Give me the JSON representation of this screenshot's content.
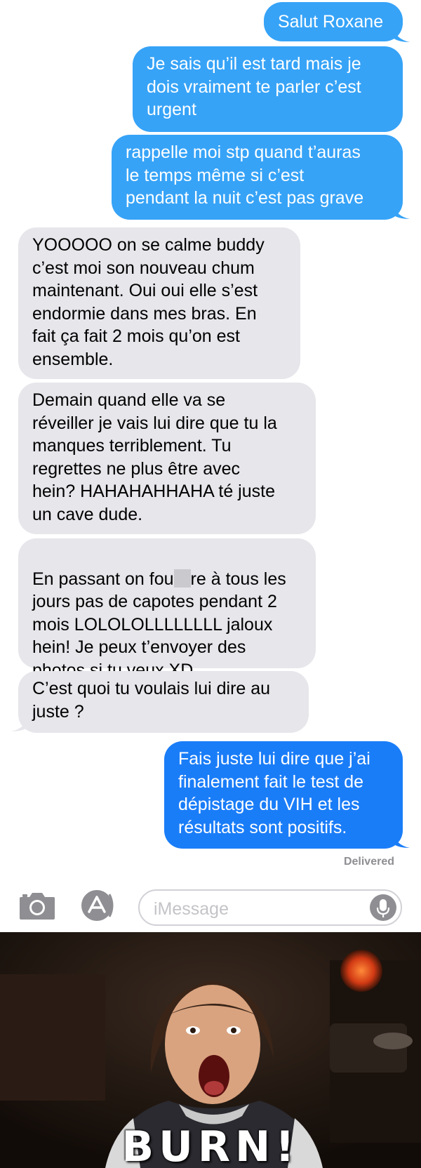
{
  "messages": [
    {
      "dir": "out",
      "text": "Salut Roxane"
    },
    {
      "dir": "out",
      "text": "Je sais qu’il est tard mais je\ndois vraiment te parler c’est\nurgent"
    },
    {
      "dir": "out",
      "text": "rappelle moi stp quand t’auras\nle temps même si c’est\npendant la nuit c’est pas grave"
    },
    {
      "dir": "in",
      "text": "YOOOOO on se calme buddy\nc’est moi son nouveau chum\nmaintenant. Oui oui elle s’est\nendormie dans mes bras. En\nfait ça fait 2 mois qu’on est\nensemble."
    },
    {
      "dir": "in",
      "text": "Demain quand elle va se\nréveiller je vais lui dire que tu la\nmanques terriblement. Tu\nregrettes ne plus être avec\nhein? HAHAHAHHAHA té juste\nun cave dude."
    },
    {
      "dir": "in",
      "text_before_censor": "En passant on fou",
      "text_after_censor": "re à tous les\njours pas de capotes pendant 2\nmois LOLOLOLLLLLLLL jaloux\nhein! Je peux t’envoyer des\nphotos si tu veux XD"
    },
    {
      "dir": "in",
      "text": "C’est quoi tu voulais lui dire au\njuste ?"
    },
    {
      "dir": "out",
      "text": "Fais juste lui dire que j’ai\nfinalement fait le test de\ndépistage du VIH et les\nrésultats sont positifs."
    }
  ],
  "status": "Delivered",
  "input": {
    "placeholder": "iMessage",
    "camera_icon": "camera-icon",
    "apps_icon": "app-store-icon",
    "mic_icon": "microphone-icon"
  },
  "gif": {
    "caption": "BURN!"
  },
  "colors": {
    "outgoing_bubble": "#36a3f7",
    "outgoing_last_bubble": "#1a7df8",
    "incoming_bubble": "#e6e6eb"
  }
}
